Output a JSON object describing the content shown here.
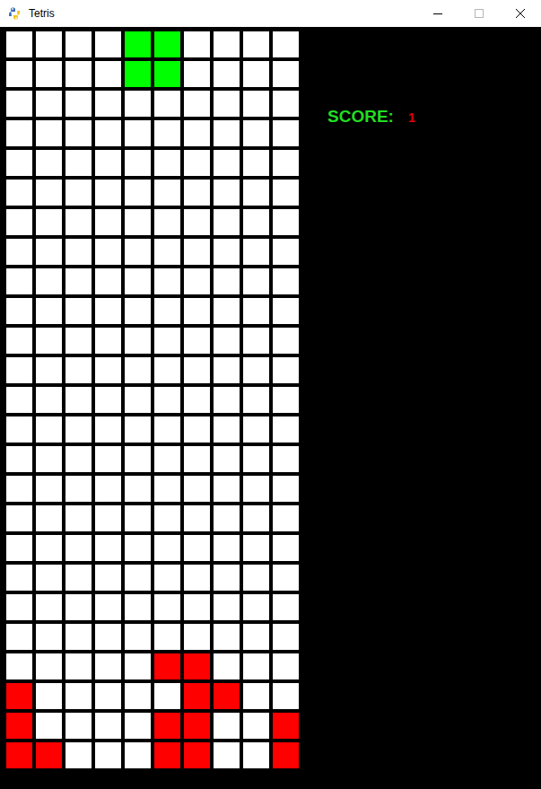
{
  "window": {
    "title": "Tetris"
  },
  "score": {
    "label": "SCORE:",
    "value": "1"
  },
  "board": {
    "rows": [
      [
        "#ffffff",
        "#ffffff",
        "#ffffff",
        "#ffffff",
        "#00ff00",
        "#00ff00",
        "#ffffff",
        "#ffffff",
        "#ffffff",
        "#ffffff"
      ],
      [
        "#ffffff",
        "#ffffff",
        "#ffffff",
        "#ffffff",
        "#00ff00",
        "#00ff00",
        "#ffffff",
        "#ffffff",
        "#ffffff",
        "#ffffff"
      ],
      [
        "#ffffff",
        "#ffffff",
        "#ffffff",
        "#ffffff",
        "#ffffff",
        "#ffffff",
        "#ffffff",
        "#ffffff",
        "#ffffff",
        "#ffffff"
      ],
      [
        "#ffffff",
        "#ffffff",
        "#ffffff",
        "#ffffff",
        "#ffffff",
        "#ffffff",
        "#ffffff",
        "#ffffff",
        "#ffffff",
        "#ffffff"
      ],
      [
        "#ffffff",
        "#ffffff",
        "#ffffff",
        "#ffffff",
        "#ffffff",
        "#ffffff",
        "#ffffff",
        "#ffffff",
        "#ffffff",
        "#ffffff"
      ],
      [
        "#ffffff",
        "#ffffff",
        "#ffffff",
        "#ffffff",
        "#ffffff",
        "#ffffff",
        "#ffffff",
        "#ffffff",
        "#ffffff",
        "#ffffff"
      ],
      [
        "#ffffff",
        "#ffffff",
        "#ffffff",
        "#ffffff",
        "#ffffff",
        "#ffffff",
        "#ffffff",
        "#ffffff",
        "#ffffff",
        "#ffffff"
      ],
      [
        "#ffffff",
        "#ffffff",
        "#ffffff",
        "#ffffff",
        "#ffffff",
        "#ffffff",
        "#ffffff",
        "#ffffff",
        "#ffffff",
        "#ffffff"
      ],
      [
        "#ffffff",
        "#ffffff",
        "#ffffff",
        "#ffffff",
        "#ffffff",
        "#ffffff",
        "#ffffff",
        "#ffffff",
        "#ffffff",
        "#ffffff"
      ],
      [
        "#ffffff",
        "#ffffff",
        "#ffffff",
        "#ffffff",
        "#ffffff",
        "#ffffff",
        "#ffffff",
        "#ffffff",
        "#ffffff",
        "#ffffff"
      ],
      [
        "#ffffff",
        "#ffffff",
        "#ffffff",
        "#ffffff",
        "#ffffff",
        "#ffffff",
        "#ffffff",
        "#ffffff",
        "#ffffff",
        "#ffffff"
      ],
      [
        "#ffffff",
        "#ffffff",
        "#ffffff",
        "#ffffff",
        "#ffffff",
        "#ffffff",
        "#ffffff",
        "#ffffff",
        "#ffffff",
        "#ffffff"
      ],
      [
        "#ffffff",
        "#ffffff",
        "#ffffff",
        "#ffffff",
        "#ffffff",
        "#ffffff",
        "#ffffff",
        "#ffffff",
        "#ffffff",
        "#ffffff"
      ],
      [
        "#ffffff",
        "#ffffff",
        "#ffffff",
        "#ffffff",
        "#ffffff",
        "#ffffff",
        "#ffffff",
        "#ffffff",
        "#ffffff",
        "#ffffff"
      ],
      [
        "#ffffff",
        "#ffffff",
        "#ffffff",
        "#ffffff",
        "#ffffff",
        "#ffffff",
        "#ffffff",
        "#ffffff",
        "#ffffff",
        "#ffffff"
      ],
      [
        "#ffffff",
        "#ffffff",
        "#ffffff",
        "#ffffff",
        "#ffffff",
        "#ffffff",
        "#ffffff",
        "#ffffff",
        "#ffffff",
        "#ffffff"
      ],
      [
        "#ffffff",
        "#ffffff",
        "#ffffff",
        "#ffffff",
        "#ffffff",
        "#ffffff",
        "#ffffff",
        "#ffffff",
        "#ffffff",
        "#ffffff"
      ],
      [
        "#ffffff",
        "#ffffff",
        "#ffffff",
        "#ffffff",
        "#ffffff",
        "#ffffff",
        "#ffffff",
        "#ffffff",
        "#ffffff",
        "#ffffff"
      ],
      [
        "#ffffff",
        "#ffffff",
        "#ffffff",
        "#ffffff",
        "#ffffff",
        "#ffffff",
        "#ffffff",
        "#ffffff",
        "#ffffff",
        "#ffffff"
      ],
      [
        "#ffffff",
        "#ffffff",
        "#ffffff",
        "#ffffff",
        "#ffffff",
        "#ffffff",
        "#ffffff",
        "#ffffff",
        "#ffffff",
        "#ffffff"
      ],
      [
        "#ffffff",
        "#ffffff",
        "#ffffff",
        "#ffffff",
        "#ffffff",
        "#ffffff",
        "#ffffff",
        "#ffffff",
        "#ffffff",
        "#ffffff"
      ],
      [
        "#ffffff",
        "#ffffff",
        "#ffffff",
        "#ffffff",
        "#ffffff",
        "#ff0000",
        "#ff0000",
        "#ffffff",
        "#ffffff",
        "#ffffff"
      ],
      [
        "#ff0000",
        "#ffffff",
        "#ffffff",
        "#ffffff",
        "#ffffff",
        "#ffffff",
        "#ff0000",
        "#ff0000",
        "#ffffff",
        "#ffffff"
      ],
      [
        "#ff0000",
        "#ffffff",
        "#ffffff",
        "#ffffff",
        "#ffffff",
        "#ff0000",
        "#ff0000",
        "#ffffff",
        "#ffffff",
        "#ff0000"
      ],
      [
        "#ff0000",
        "#ff0000",
        "#ffffff",
        "#ffffff",
        "#ffffff",
        "#ff0000",
        "#ff0000",
        "#ffffff",
        "#ffffff",
        "#ff0000"
      ]
    ]
  }
}
